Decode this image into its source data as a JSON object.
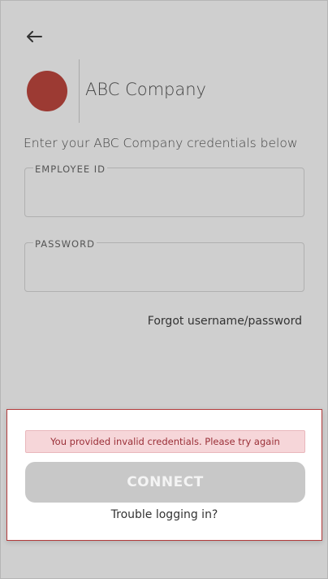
{
  "header": {
    "back_icon": "arrow-left-icon"
  },
  "brand": {
    "logo_color": "#9c3a33",
    "company_name": "ABC Company"
  },
  "form": {
    "instructions": "Enter your ABC Company credentials below",
    "employee_id": {
      "label": "EMPLOYEE ID",
      "value": ""
    },
    "password": {
      "label": "PASSWORD",
      "value": ""
    },
    "forgot_link": "Forgot username/password"
  },
  "bottom_sheet": {
    "error_message": "You provided invalid credentials. Please try again",
    "connect_label": "CONNECT",
    "trouble_link": "Trouble logging in?",
    "error_color": "#9a2f37"
  }
}
